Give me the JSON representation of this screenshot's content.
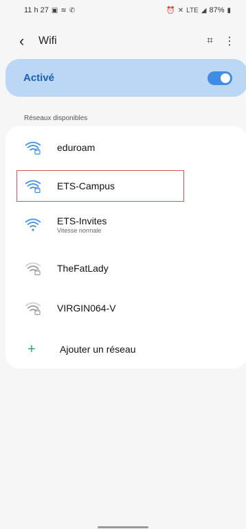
{
  "status_bar": {
    "time": "11 h 27",
    "left_icons": [
      "image-icon",
      "wifi-icon",
      "call-icon"
    ],
    "right_icons": [
      "alarm-icon",
      "mute-icon",
      "lte-icon",
      "signal-icon"
    ],
    "battery": "87%"
  },
  "app_bar": {
    "title": "Wifi",
    "back_icon": "back-chevron-icon",
    "action_icons": [
      "qr-scan-icon",
      "more-vert-icon"
    ]
  },
  "wifi_toggle": {
    "label": "Activé",
    "enabled": true,
    "accent": "#3d8ce6"
  },
  "section": {
    "header": "Réseaux disponibles"
  },
  "networks": [
    {
      "name": "eduroam",
      "sub": "",
      "secured": true,
      "strength": "strong",
      "color": "#3d8ce6"
    },
    {
      "name": "ETS-Campus",
      "sub": "",
      "secured": true,
      "strength": "strong",
      "color": "#3d8ce6",
      "highlighted": true
    },
    {
      "name": "ETS-Invites",
      "sub": "Vitesse normale",
      "secured": false,
      "strength": "strong",
      "color": "#3d8ce6"
    },
    {
      "name": "TheFatLady",
      "sub": "",
      "secured": true,
      "strength": "weak",
      "color": "#9a9a9a"
    },
    {
      "name": "VIRGIN064-V",
      "sub": "",
      "secured": true,
      "strength": "weak",
      "color": "#9a9a9a"
    }
  ],
  "add_network": {
    "label": "Ajouter un réseau",
    "icon": "plus-icon"
  }
}
